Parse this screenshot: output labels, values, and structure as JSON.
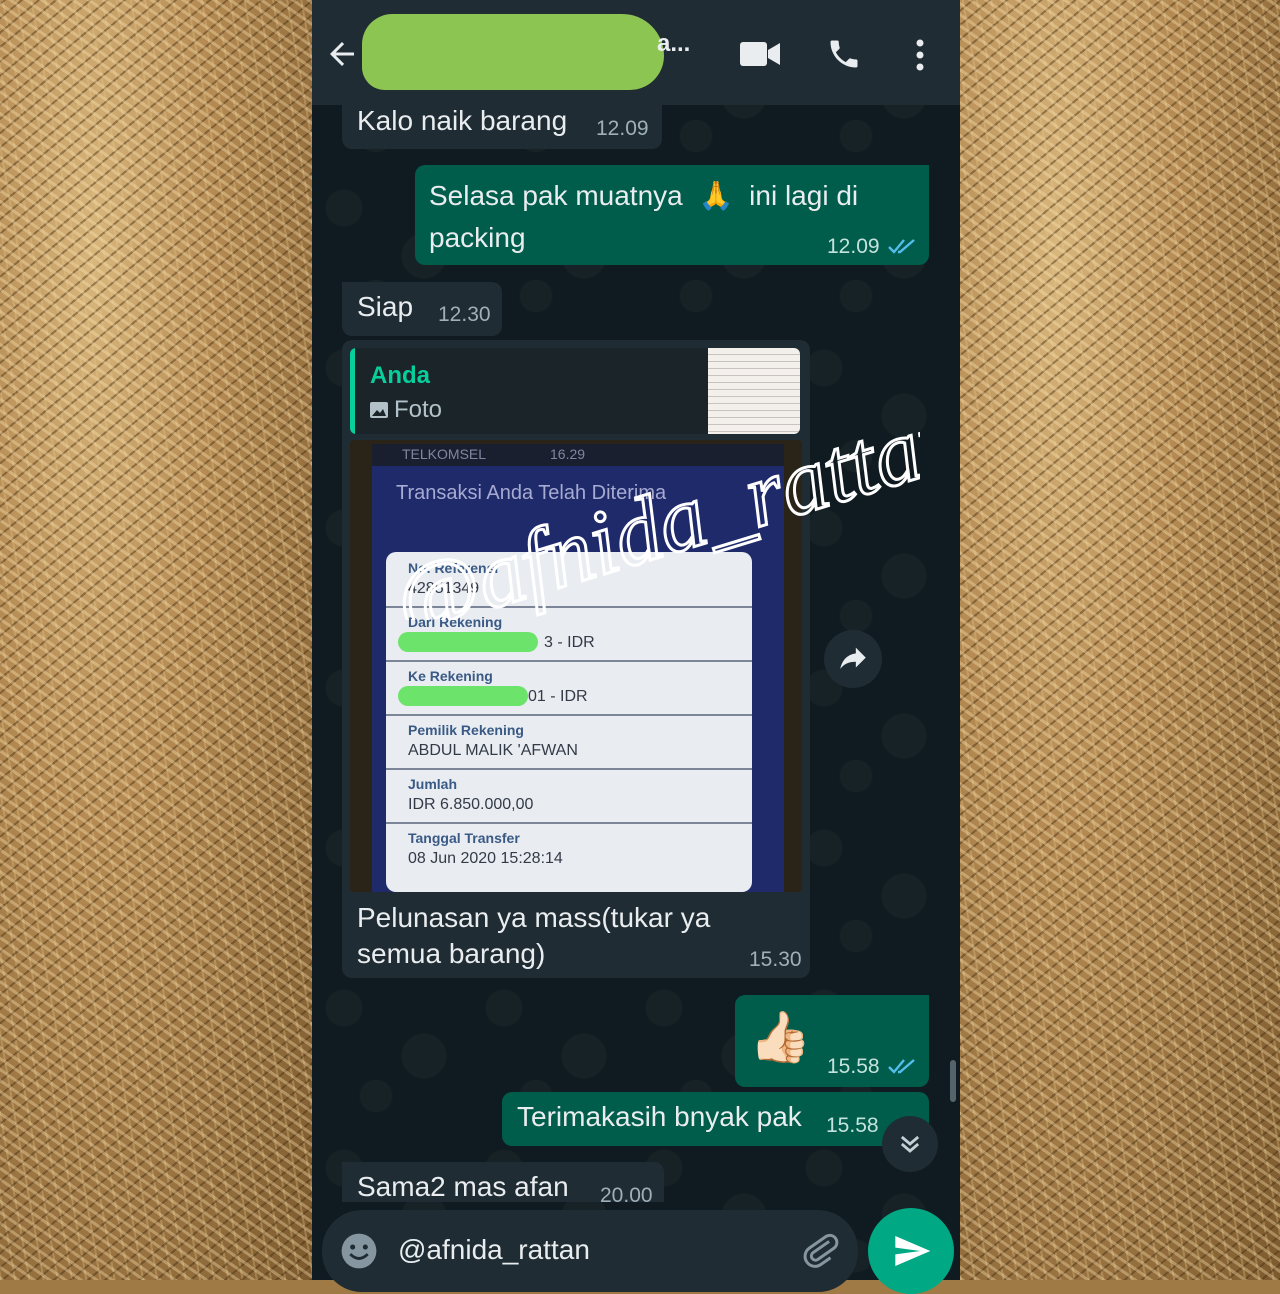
{
  "header": {
    "contact_name": "a..."
  },
  "messages": [
    {
      "text": "Kalo naik barang",
      "time": "12.09",
      "direction": "incoming"
    },
    {
      "text_before_emoji": "Selasa pak muatnya",
      "emoji": "🙏",
      "text_after_emoji": "ini lagi di",
      "text_line2": "packing",
      "time": "12.09",
      "direction": "outgoing",
      "status": "read"
    },
    {
      "text": "Siap",
      "time": "12.30",
      "direction": "incoming"
    },
    {
      "direction": "incoming",
      "quoted": {
        "author": "Anda",
        "type": "Foto"
      },
      "photo": {
        "carrier": "TELKOMSEL",
        "clock": "16.29",
        "title": "Transaksi Anda Telah Diterima",
        "fields": [
          {
            "label": "No. Referensi",
            "value": "42851349"
          },
          {
            "label": "Dari Rekening",
            "value": "3 - IDR"
          },
          {
            "label": "Ke Rekening",
            "value": "01 - IDR"
          },
          {
            "label": "Pemilik Rekening",
            "value": "ABDUL MALIK 'AFWAN"
          },
          {
            "label": "Jumlah",
            "value": "IDR 6.850.000,00"
          },
          {
            "label": "Tanggal Transfer",
            "value": "08 Jun 2020 15:28:14"
          }
        ]
      },
      "caption_line1": "Pelunasan ya mass(tukar ya",
      "caption_line2": "semua barang)",
      "time": "15.30"
    },
    {
      "emoji": "👍🏻",
      "time": "15.58",
      "direction": "outgoing",
      "status": "read"
    },
    {
      "text": "Terimakasih bnyak pak",
      "time": "15.58",
      "direction": "outgoing"
    },
    {
      "text": "Sama2 mas afan",
      "time": "20.00",
      "direction": "incoming"
    }
  ],
  "watermark": "@afnida_rattan",
  "composer": {
    "text": "@afnida_rattan"
  },
  "colors": {
    "header_bg": "#1f2c33",
    "chat_bg": "#0f1b20",
    "incoming_bubble": "#202c33",
    "outgoing_bubble": "#005c4b",
    "accent": "#00a884",
    "read_ticks": "#53bdeb",
    "redaction": "#8dc552"
  },
  "icons": [
    "back-arrow-icon",
    "video-call-icon",
    "phone-call-icon",
    "more-vert-icon",
    "forward-icon",
    "scroll-down-icon",
    "emoji-icon",
    "attach-icon",
    "send-icon",
    "read-ticks-icon",
    "photo-icon"
  ]
}
